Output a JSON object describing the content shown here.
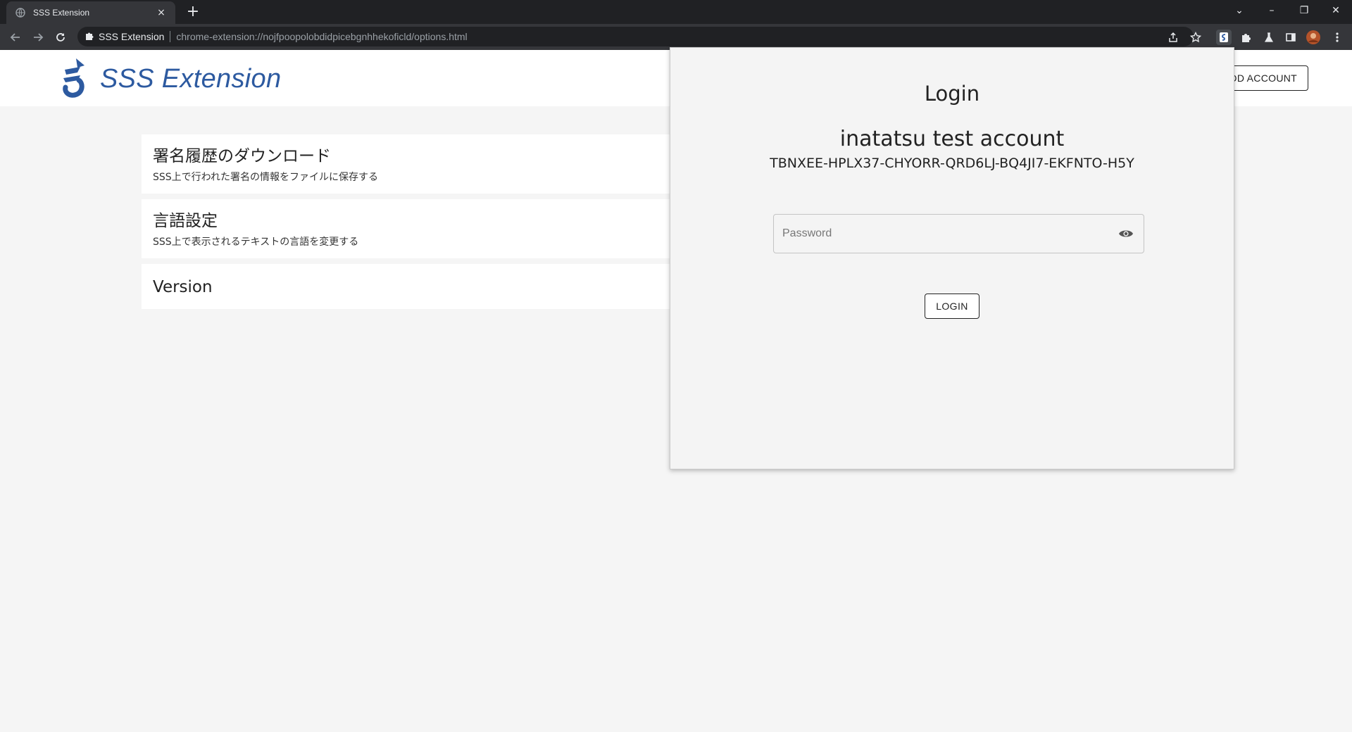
{
  "browser": {
    "tab_title": "SSS Extension",
    "tab_close": "×",
    "new_tab": "+",
    "omnibox_site": "SSS Extension",
    "omnibox_url": "chrome-extension://nojfpoopolobdidpicebgnhhekoficld/options.html",
    "window_controls": {
      "dropdown": "⌄",
      "minimize": "–",
      "restore": "❐",
      "close": "✕"
    }
  },
  "header": {
    "app_title": "SSS Extension",
    "add_account_label": "ADD ACCOUNT",
    "brand_color": "#2d5aa0"
  },
  "settings": {
    "items": [
      {
        "title": "署名履歴のダウンロード",
        "description": "SSS上で行われた署名の情報をファイルに保存する"
      },
      {
        "title": "言語設定",
        "description": "SSS上で表示されるテキストの言語を変更する"
      },
      {
        "title": "Version"
      }
    ]
  },
  "login_popup": {
    "title": "Login",
    "account_name": "inatatsu test account",
    "account_address": "TBNXEE-HPLX37-CHYORR-QRD6LJ-BQ4JI7-EKFNTO-H5Y",
    "password_placeholder": "Password",
    "password_value": "",
    "show_password_icon": "eye-icon",
    "login_label": "LOGIN"
  }
}
